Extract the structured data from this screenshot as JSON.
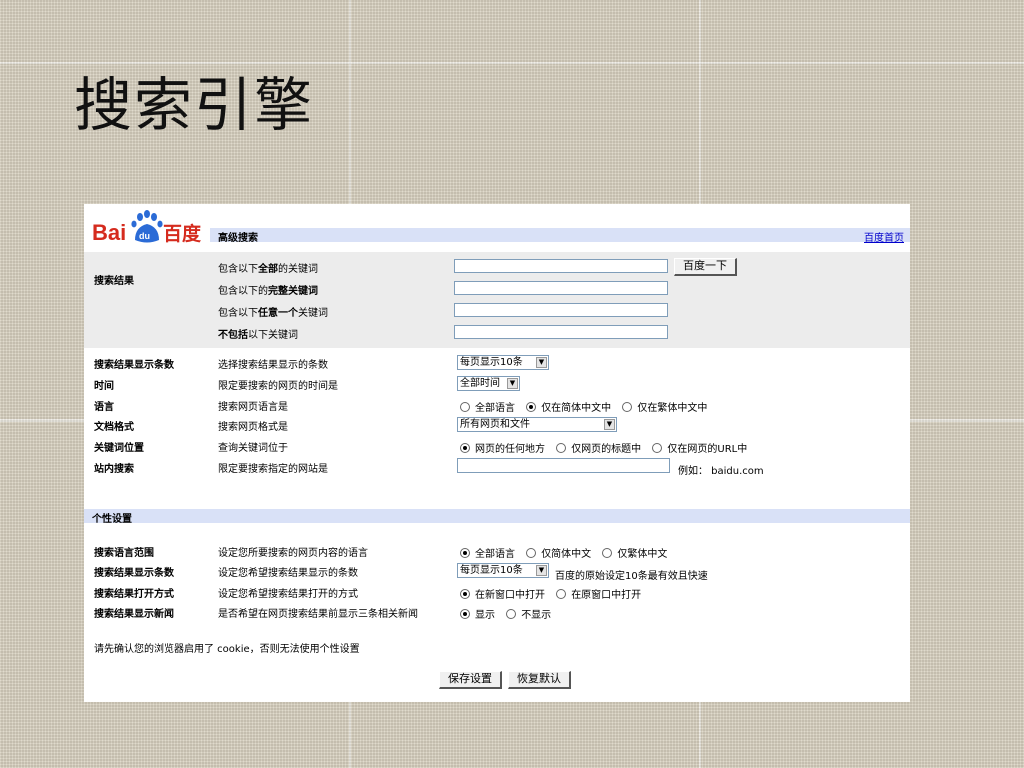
{
  "slide_title": "搜索引擎",
  "header": {
    "title": "高级搜索",
    "home_link": "百度首页"
  },
  "search_results": {
    "section_label": "搜索结果",
    "rows": [
      {
        "prefix": "包含以下",
        "bold": "全部",
        "suffix": "的关键词"
      },
      {
        "prefix": "包含以下的",
        "bold": "完整关键词",
        "suffix": ""
      },
      {
        "prefix": "包含以下",
        "bold": "任意一个",
        "suffix": "关键词"
      },
      {
        "prefix": "",
        "bold": "不包括",
        "suffix": "以下关键词"
      }
    ],
    "search_button": "百度一下"
  },
  "options": [
    {
      "label": "搜索结果显示条数",
      "desc": "选择搜索结果显示的条数"
    },
    {
      "label": "时间",
      "desc": "限定要搜索的网页的时间是"
    },
    {
      "label": "语言",
      "desc": "搜索网页语言是"
    },
    {
      "label": "文档格式",
      "desc": "搜索网页格式是"
    },
    {
      "label": "关键词位置",
      "desc": "查询关键词位于"
    },
    {
      "label": "站内搜索",
      "desc": "限定要搜索指定的网站是"
    }
  ],
  "controls": {
    "results_count": "每页显示10条",
    "time": "全部时间",
    "language_options": [
      "全部语言",
      "仅在简体中文中",
      "仅在繁体中文中"
    ],
    "language_selected": 1,
    "format": "所有网页和文件",
    "keyword_position_options": [
      "网页的任何地方",
      "仅网页的标题中",
      "仅在网页的URL中"
    ],
    "keyword_position_selected": 0,
    "site_example": "例如： baidu.com"
  },
  "personal": {
    "section_title": "个性设置",
    "rows": [
      {
        "label": "搜索语言范围",
        "desc": "设定您所要搜索的网页内容的语言"
      },
      {
        "label": "搜索结果显示条数",
        "desc": "设定您希望搜索结果显示的条数"
      },
      {
        "label": "搜索结果打开方式",
        "desc": "设定您希望搜索结果打开的方式"
      },
      {
        "label": "搜索结果显示新闻",
        "desc": "是否希望在网页搜索结果前显示三条相关新闻"
      }
    ],
    "lang_scope_options": [
      "全部语言",
      "仅简体中文",
      "仅繁体中文"
    ],
    "lang_scope_selected": 0,
    "count_select": "每页显示10条",
    "count_note": "百度的原始设定10条最有效且快速",
    "open_options": [
      "在新窗口中打开",
      "在原窗口中打开"
    ],
    "open_selected": 0,
    "news_options": [
      "显示",
      "不显示"
    ],
    "news_selected": 0,
    "cookie_note": "请先确认您的浏览器启用了 cookie，否则无法使用个性设置",
    "save_button": "保存设置",
    "reset_button": "恢复默认"
  },
  "logo": {
    "text_left": "Bai",
    "paw": "du",
    "text_right": "百度"
  }
}
